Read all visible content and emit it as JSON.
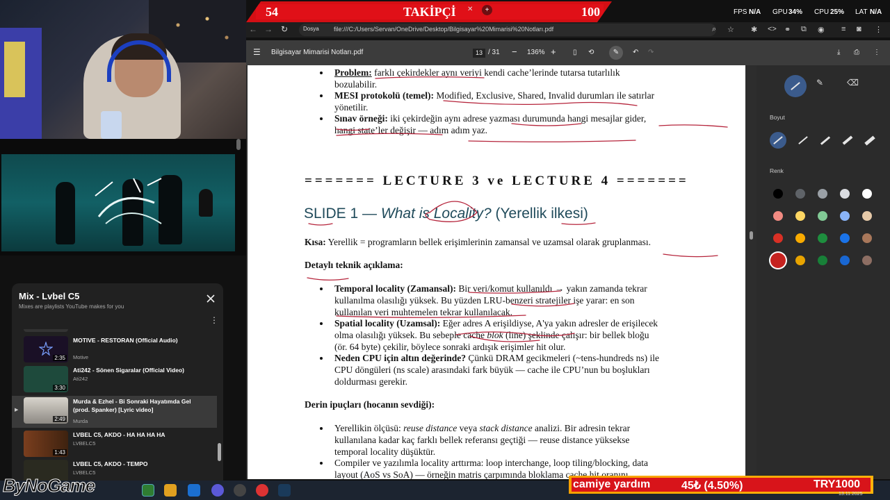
{
  "follower_bar": {
    "current": "54",
    "label": "TAKİPÇİ",
    "goal": "100"
  },
  "stats": {
    "fps_label": "FPS",
    "fps": "N/A",
    "gpu_label": "GPU",
    "gpu": "34%",
    "cpu_label": "CPU",
    "cpu": "25%",
    "lat_label": "LAT",
    "lat": "N/A"
  },
  "browser": {
    "chip": "Dosya",
    "url": "file:///C:/Users/Servan/OneDrive/Desktop/Bilgisayar%20Mimarisi%20Notları.pdf"
  },
  "pdf_toolbar": {
    "title": "Bilgisayar Mimarisi Notları.pdf",
    "page": "13",
    "page_total": "/ 31",
    "zoom": "136%"
  },
  "pdf": {
    "top_bullets": [
      {
        "bold": "Problem:",
        "text": " farklı çekirdekler aynı veriyi kendi cache’lerinde tutarsa tutarlılık",
        "cont": "bozulabilir."
      },
      {
        "bold": "MESI protokolü (temel):",
        "text": " Modified, Exclusive, Shared, Invalid durumları ile satırlar",
        "cont": "yönetilir."
      },
      {
        "bold": "Sınav örneği:",
        "text": " iki çekirdeğin aynı adrese yazması durumunda hangi mesajlar gider,",
        "cont": "hangi state’ler değişir — adım adım yaz."
      }
    ],
    "lecture_heading": "======= LECTURE 3 ve LECTURE 4 =======",
    "slide_prefix": "SLIDE 1 — ",
    "slide_italic": "What is Locality?",
    "slide_suffix": " (Yerellik ilkesi)",
    "kisa_label": "Kısa:",
    "kisa_text": " Yerellik = programların bellek erişimlerinin zamansal ve uzamsal olarak gruplanması.",
    "detay_heading": "Detaylı teknik açıklama:",
    "temporal_bold": "Temporal locality (Zamansal):",
    "temporal_1": " Bir veri/komut kullanıldı → yakın zamanda tekrar",
    "temporal_2": "kullanılma olasılığı yüksek. Bu yüzden LRU-benzeri stratejiler işe yarar: en son",
    "temporal_3": "kullanılan veri muhtemelen tekrar kullanılacak.",
    "spatial_bold": "Spatial locality (Uzamsal):",
    "spatial_1": " Eğer adres A erişildiyse, A'ya yakın adresler de erişilecek",
    "spatial_2a": "olma olasılığı yüksek. Bu sebeple cache ",
    "spatial_2i": "blok",
    "spatial_2b": " (line) şeklinde çalışır: bir bellek bloğu",
    "spatial_3": "(ör. 64 byte) çekilir, böylece sonraki ardışık erişimler hit olur.",
    "cpu_bold": "Neden CPU için altın değerinde?",
    "cpu_1": " Çünkü DRAM gecikmeleri (~tens-hundreds ns) ile",
    "cpu_2": "CPU döngüleri (ns scale) arasındaki fark büyük — cache ile CPU’nun bu boşlukları",
    "cpu_3": "doldurması gerekir.",
    "derin_heading": "Derin ipuçları (hocanın sevdiği):",
    "tip1_a": "Yerellikin ölçüsü: ",
    "tip1_i1": "reuse distance",
    "tip1_b": " veya ",
    "tip1_i2": "stack distance",
    "tip1_c": " analizi. Bir adresin tekrar",
    "tip1_2": "kullanılana kadar kaç farklı bellek referansı geçtiği — reuse distance yüksekse",
    "tip1_3": "temporal locality düşüktür.",
    "tip2_1": "Compiler ve yazılımla locality arttırma: loop interchange, loop tiling/blocking, data",
    "tip2_2": "layout (AoS vs SoA) — örneğin matris çarpımında bloklama cache hit oranını"
  },
  "draw_panel": {
    "size_label": "Boyut",
    "color_label": "Renk",
    "colors": [
      "#000000",
      "#5f6368",
      "#9aa0a6",
      "#dadce0",
      "#ffffff",
      "#f28b82",
      "#fdd663",
      "#81c995",
      "#8ab4f8",
      "#e6c9a8",
      "#d93025",
      "#f9ab00",
      "#1e8e3e",
      "#1a73e8",
      "#a8775a",
      "#c5221f",
      "#e8a400",
      "#188038",
      "#1967d2",
      "#8d6e63"
    ]
  },
  "playlist": {
    "title": "Mix - Lvbel C5",
    "subtitle": "Mixes are playlists YouTube makes for you",
    "items": [
      {
        "title": "MOTIVE - RESTORAN (Official Audio)",
        "channel": "Motive",
        "duration": "2:35",
        "thumb": "#1a1026"
      },
      {
        "title": "Ati242 - Sönen Sigaralar (Official Video)",
        "channel": "Ati242",
        "duration": "3:30",
        "thumb": "#1e4a3c"
      },
      {
        "title": "Murda & Ezhel - Bi Sonraki Hayatımda Gel (prod. Spanker) [Lyric video]",
        "channel": "Murda",
        "duration": "2:49",
        "thumb": "#b9b6b0",
        "active": true
      },
      {
        "title": "LVBEL C5, AKDO - HA HA HA HA",
        "channel": "LVBELC5",
        "duration": "1:43",
        "thumb": "#6b3a1c"
      },
      {
        "title": "LVBEL C5, AKDO - TEMPO",
        "channel": "LVBELC5",
        "duration": "",
        "thumb": "#2a2a20"
      }
    ]
  },
  "overlays": {
    "brand": "ByNoGame",
    "donation_name": "camiye yardım",
    "donation_amount": "45₺ (4.50%)",
    "donation_goal": "TRY1000",
    "date": "13.11.2025"
  }
}
